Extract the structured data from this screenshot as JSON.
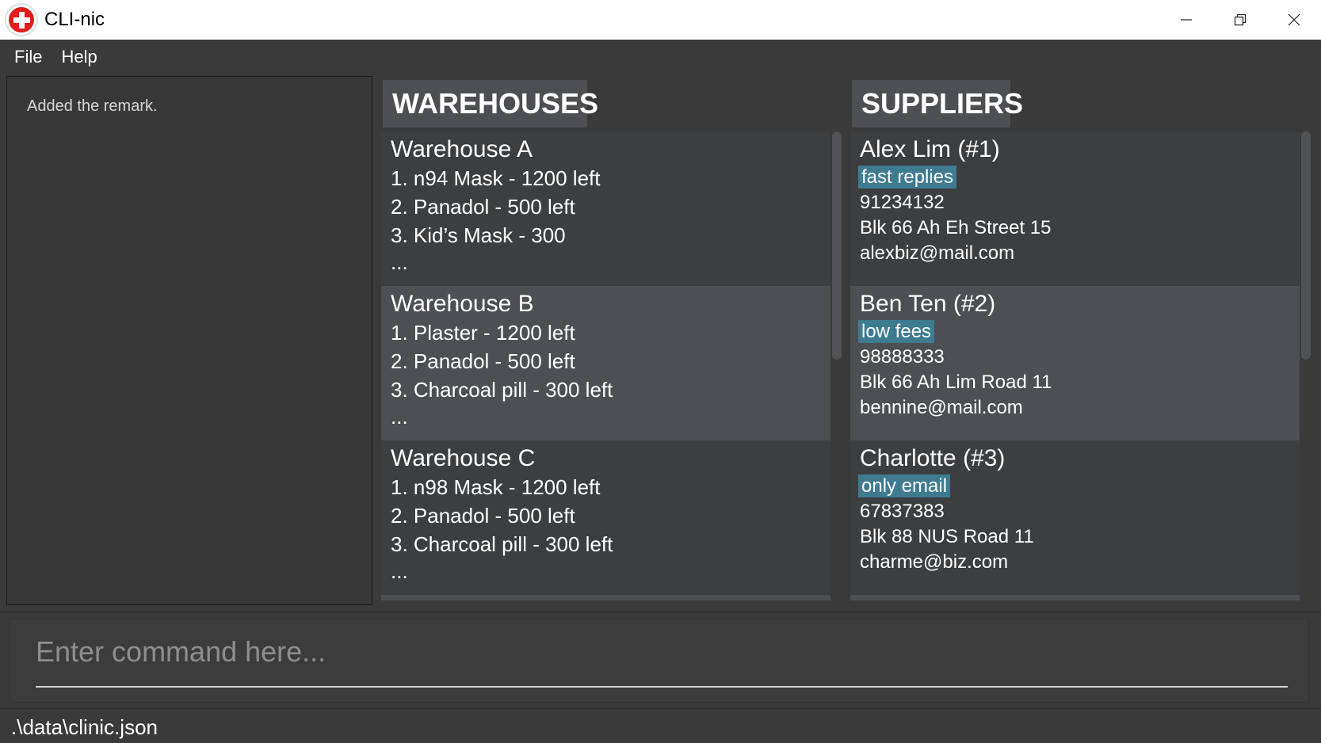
{
  "window": {
    "title": "CLI-nic",
    "icon": "red-cross-icon",
    "controls": [
      "minimize-icon",
      "restore-icon",
      "close-icon"
    ]
  },
  "menu": {
    "items": [
      {
        "label": "File"
      },
      {
        "label": "Help"
      }
    ]
  },
  "result": {
    "text": "Added the remark."
  },
  "warehouses": {
    "header": "WAREHOUSES",
    "items": [
      {
        "name": "Warehouse A",
        "lines": [
          "1. n94 Mask - 1200 left",
          "2. Panadol - 500 left",
          "3. Kid’s Mask - 300",
          "..."
        ]
      },
      {
        "name": "Warehouse B",
        "lines": [
          "1. Plaster - 1200 left",
          "2. Panadol - 500 left",
          "3. Charcoal pill - 300 left",
          "..."
        ]
      },
      {
        "name": "Warehouse C",
        "lines": [
          "1. n98 Mask - 1200 left",
          "2. Panadol - 500 left",
          "3. Charcoal pill - 300 left",
          "..."
        ]
      }
    ]
  },
  "suppliers": {
    "header": "SUPPLIERS",
    "items": [
      {
        "name": "Alex Lim (#1)",
        "tag": "fast replies",
        "phone": "91234132",
        "address": "Blk 66 Ah Eh Street 15",
        "email": "alexbiz@mail.com"
      },
      {
        "name": "Ben Ten (#2)",
        "tag": "low fees",
        "phone": "98888333",
        "address": "Blk 66 Ah Lim Road 11",
        "email": "bennine@mail.com"
      },
      {
        "name": "Charlotte (#3)",
        "tag": "only email",
        "phone": "67837383",
        "address": "Blk 88 NUS Road 11",
        "email": "charme@biz.com"
      }
    ]
  },
  "command": {
    "placeholder": "Enter command here...",
    "value": ""
  },
  "status": {
    "path": ".\\data\\clinic.json"
  },
  "colors": {
    "background": "#3a3a3a",
    "card_dark": "#3c3e40",
    "card_light": "#4d4f52",
    "tag": "#3e7b91",
    "icon_red": "#e21b1b"
  }
}
